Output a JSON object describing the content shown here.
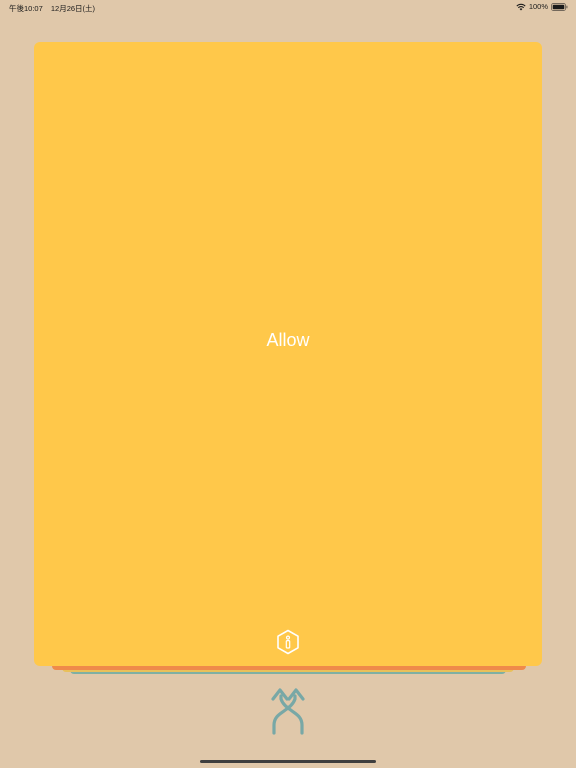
{
  "status_bar": {
    "time": "午後10:07",
    "date": "12月26日(土)",
    "battery": "100%",
    "wifi_icon": "wifi-icon",
    "battery_icon": "battery-icon"
  },
  "card": {
    "label": "Allow",
    "background_color": "#ffc84a",
    "label_color": "#ffffff",
    "info_icon": "info-hexagon-icon"
  },
  "stack_colors": [
    "#ef8a4a",
    "#e9c05a",
    "#7fb0a3"
  ],
  "bottom": {
    "shuffle_icon": "shuffle-arrows-icon",
    "icon_color": "#78a8a6"
  },
  "page_background": "#e0c8aa"
}
